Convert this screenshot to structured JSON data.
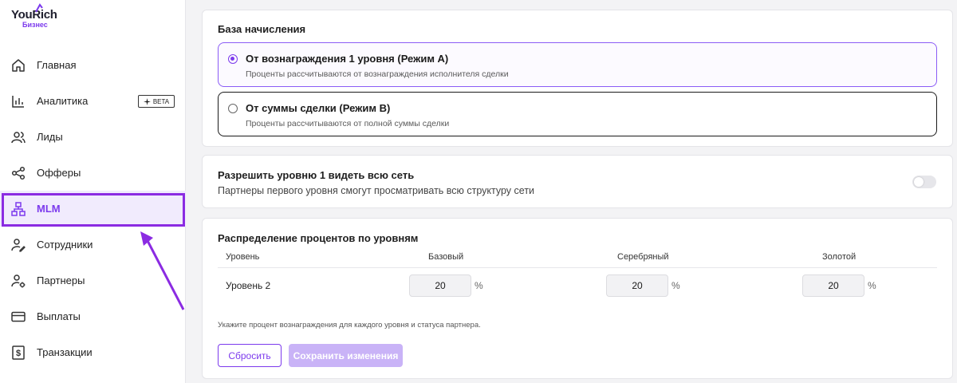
{
  "app": {
    "logo_text_left": "You",
    "logo_text_right": "ich",
    "logo_r": "R",
    "logo_sub": "Бизнес",
    "accent": "#7c3aed"
  },
  "sidebar": {
    "items": [
      {
        "label": "Главная",
        "icon": "home-icon"
      },
      {
        "label": "Аналитика",
        "icon": "bar-chart-icon",
        "badge": "BETA"
      },
      {
        "label": "Лиды",
        "icon": "users-icon"
      },
      {
        "label": "Офферы",
        "icon": "share-icon"
      },
      {
        "label": "MLM",
        "icon": "hierarchy-icon",
        "active": true
      },
      {
        "label": "Сотрудники",
        "icon": "user-edit-icon"
      },
      {
        "label": "Партнеры",
        "icon": "user-gear-icon"
      },
      {
        "label": "Выплаты",
        "icon": "credit-card-icon"
      },
      {
        "label": "Транзакции",
        "icon": "dollar-receipt-icon"
      }
    ]
  },
  "base": {
    "title": "База начисления",
    "options": [
      {
        "title": "От вознаграждения 1 уровня (Режим A)",
        "desc": "Проценты рассчитываются от вознаграждения исполнителя сделки",
        "selected": true
      },
      {
        "title": "От суммы сделки (Режим B)",
        "desc": "Проценты рассчитываются от полной суммы сделки",
        "selected": false
      }
    ]
  },
  "network": {
    "title": "Разрешить уровню 1 видеть всю сеть",
    "desc": "Партнеры первого уровня смогут просматривать всю структуру сети",
    "enabled": false
  },
  "distribution": {
    "title": "Распределение процентов по уровням",
    "columns": [
      "Уровень",
      "Базовый",
      "Серебряный",
      "Золотой"
    ],
    "rows": [
      {
        "level": "Уровень 2",
        "values": [
          "20",
          "20",
          "20"
        ],
        "unit": "%"
      }
    ],
    "hint": "Укажите процент вознаграждения для каждого уровня и статуса партнера.",
    "reset_label": "Сбросить",
    "save_label": "Сохранить изменения"
  }
}
